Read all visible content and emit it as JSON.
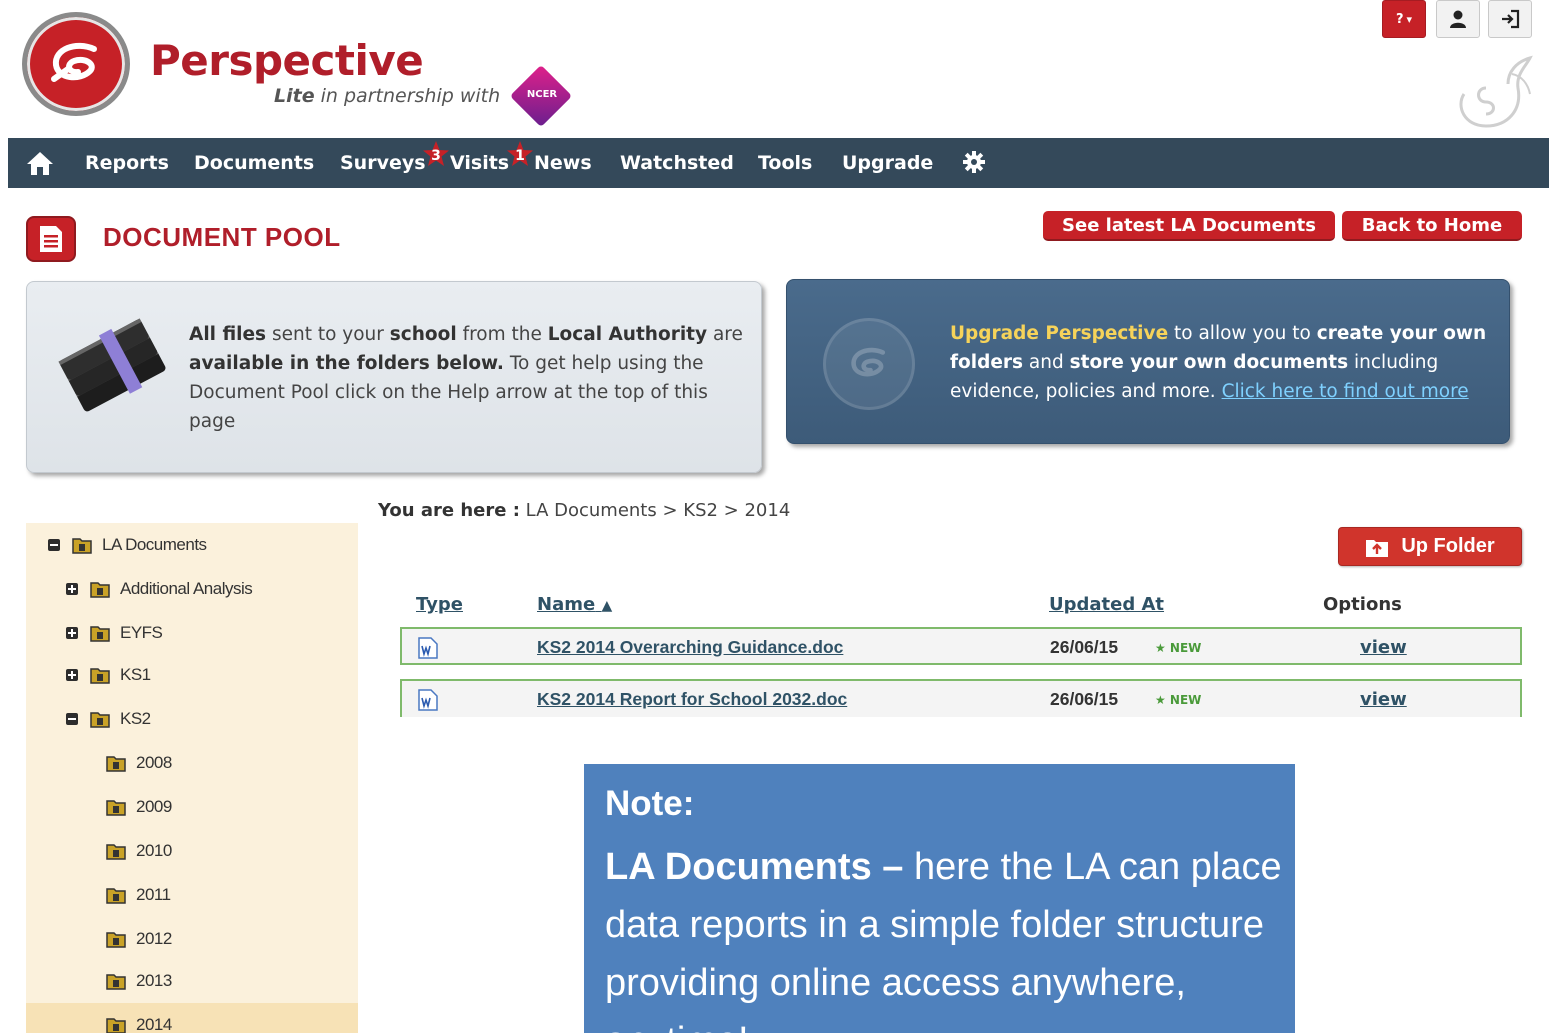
{
  "header": {
    "brand_title": "Perspective",
    "brand_sub_bold": "Lite",
    "brand_sub_rest": " in partnership with",
    "partner_badge": "NCER",
    "help_label": "?",
    "help_caret": "▾"
  },
  "nav": {
    "items": [
      "Reports",
      "Documents",
      "Surveys",
      "Visits",
      "News",
      "Watchsted",
      "Tools",
      "Upgrade"
    ],
    "badges": {
      "surveys": "3",
      "visits": "1"
    }
  },
  "page": {
    "title": "DOCUMENT POOL",
    "btn_latest": "See latest LA Documents",
    "btn_home": "Back to Home"
  },
  "info": {
    "p1": "All files",
    "p2": " sent to your ",
    "p3": "school",
    "p4": " from the ",
    "p5": "Local Authority",
    "p6": " are ",
    "p7": "available in the folders below.",
    "p8": " To get help using the Document Pool click on the Help arrow at the top of this page"
  },
  "upgrade": {
    "u1": "Upgrade Perspective",
    "u2": " to allow you to ",
    "u3": "create your own folders",
    "u4": " and ",
    "u5": "store your own documents",
    "u6": " including evidence, policies and more. ",
    "link": "Click here to find out more"
  },
  "tree": {
    "root": "LA Documents",
    "items": [
      "Additional Analysis",
      "EYFS",
      "KS1",
      "KS2"
    ],
    "years": [
      "2008",
      "2009",
      "2010",
      "2011",
      "2012",
      "2013",
      "2014"
    ]
  },
  "breadcrumb": {
    "prefix": "You are here :",
    "path": " LA Documents > KS2 > 2014"
  },
  "table": {
    "up_folder": "Up Folder",
    "headers": {
      "type": "Type",
      "name": "Name",
      "sort_arrow": "▲",
      "updated": "Updated At",
      "options": "Options"
    },
    "rows": [
      {
        "name": "KS2 2014 Overarching Guidance.doc",
        "date": "26/06/15",
        "badge": "★ NEW",
        "action": "view"
      },
      {
        "name": "KS2 2014 Report for School 2032.doc",
        "date": "26/06/15",
        "badge": "★ NEW",
        "action": "view"
      }
    ]
  },
  "note": {
    "title": "Note:",
    "bold": "LA Documents",
    "dash": " – ",
    "text": "here the LA can place data reports in a simple folder structure providing online access anywhere, anytime!"
  },
  "colors": {
    "brand_red": "#c62127",
    "nav_bg": "#34495a",
    "tree_bg": "#fbf1dc",
    "note_bg": "#4f81bd",
    "row_border": "#7fba6b"
  }
}
